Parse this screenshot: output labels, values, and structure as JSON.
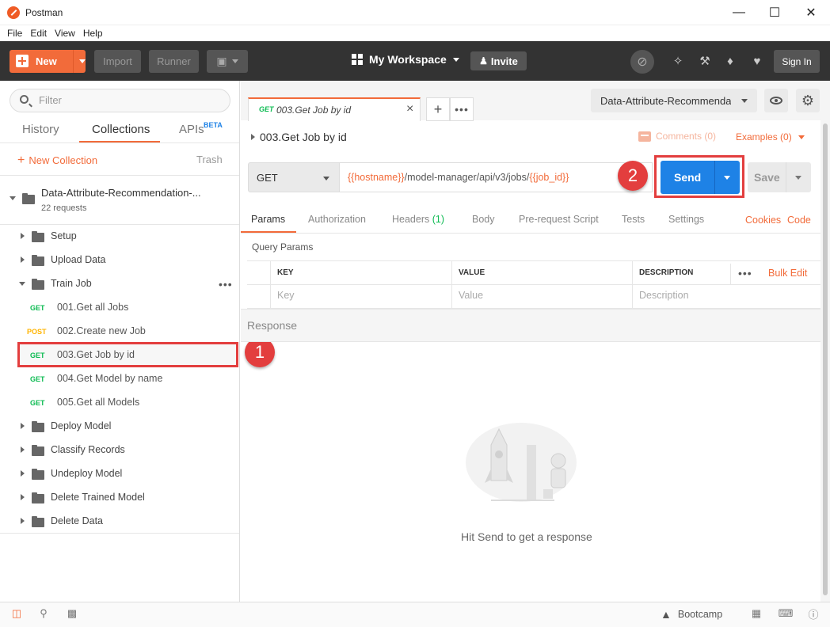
{
  "window": {
    "title": "Postman",
    "menu": [
      "File",
      "Edit",
      "View",
      "Help"
    ]
  },
  "toolbar": {
    "new_label": "New",
    "import_label": "Import",
    "runner_label": "Runner",
    "workspace_label": "My Workspace",
    "invite_label": "Invite",
    "signin_label": "Sign In"
  },
  "sidebar": {
    "filter_placeholder": "Filter",
    "tabs": [
      "History",
      "Collections",
      "APIs"
    ],
    "beta_label": "BETA",
    "new_collection_label": "New Collection",
    "trash_label": "Trash",
    "collection": {
      "name": "Data-Attribute-Recommendation-...",
      "count": "22 requests"
    },
    "folders_top": [
      "Setup",
      "Upload Data",
      "Train Job"
    ],
    "requests": [
      {
        "method": "GET",
        "name": "001.Get all Jobs"
      },
      {
        "method": "POST",
        "name": "002.Create new Job"
      },
      {
        "method": "GET",
        "name": "003.Get Job by id"
      },
      {
        "method": "GET",
        "name": "004.Get Model by name"
      },
      {
        "method": "GET",
        "name": "005.Get all Models"
      }
    ],
    "folders_bottom": [
      "Deploy Model",
      "Classify Records",
      "Undeploy Model",
      "Delete Trained Model",
      "Delete Data"
    ]
  },
  "annotations": {
    "badge1": "1",
    "badge2": "2"
  },
  "main": {
    "tab": {
      "method": "GET",
      "name": "003.Get Job by id"
    },
    "environment": "Data-Attribute-Recommenda",
    "request_title": "003.Get Job by id",
    "comments_label": "Comments (0)",
    "examples_label": "Examples (0)",
    "method": "GET",
    "url": {
      "var1": "{{hostname}}",
      "path": "/model-manager/api/v3/jobs/",
      "var2": "{{job_id}}"
    },
    "send_label": "Send",
    "save_label": "Save",
    "param_tabs": [
      "Params",
      "Authorization",
      "Headers",
      "Body",
      "Pre-request Script",
      "Tests",
      "Settings"
    ],
    "headers_count": "(1)",
    "cookies_label": "Cookies",
    "code_label": "Code",
    "query_params_title": "Query Params",
    "table": {
      "headers": [
        "KEY",
        "VALUE",
        "DESCRIPTION"
      ],
      "placeholders": [
        "Key",
        "Value",
        "Description"
      ],
      "bulk_edit_label": "Bulk Edit"
    },
    "response_title": "Response",
    "response_hint": "Hit Send to get a response"
  },
  "statusbar": {
    "bootcamp_label": "Bootcamp"
  },
  "colors": {
    "accent": "#f26b3a",
    "send_blue": "#1e82e6",
    "get_green": "#0cbb52",
    "post_yellow": "#ffb400",
    "annotation_red": "#e33e3e"
  }
}
